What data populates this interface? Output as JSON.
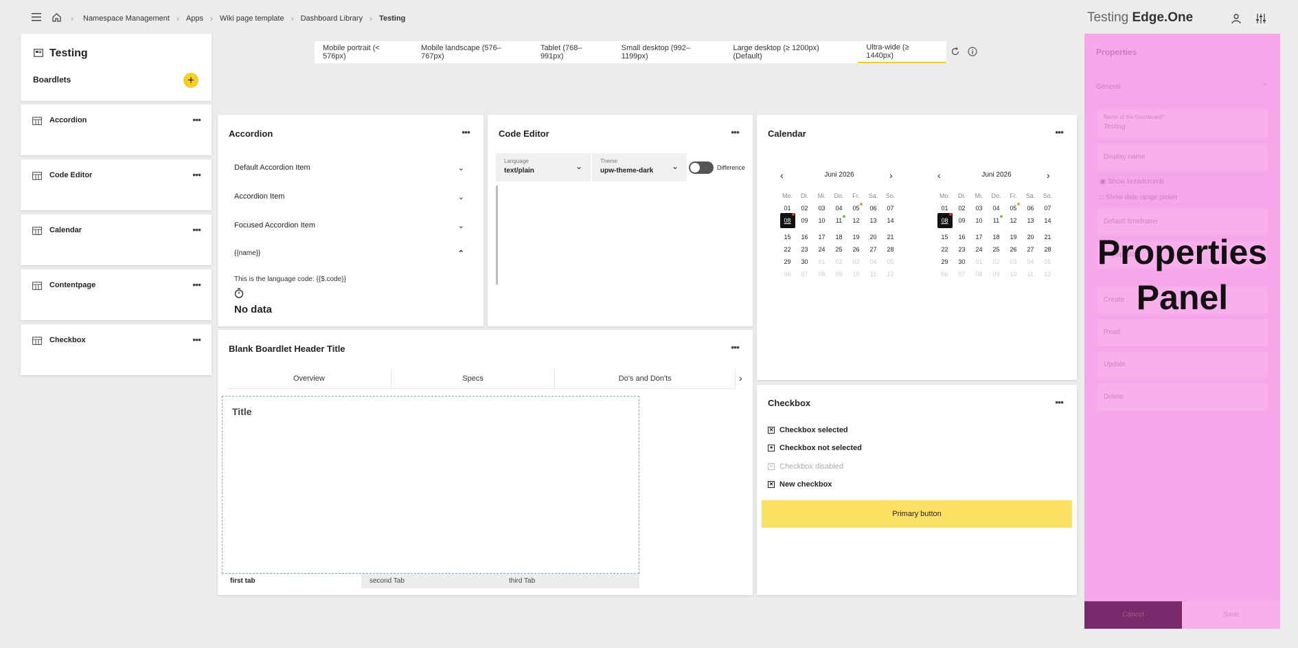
{
  "topbar": {
    "breadcrumbs": [
      "Namespace Management",
      "Apps",
      "Wiki page template",
      "Dashboard Library",
      "Testing"
    ],
    "brand_prefix": "Testing",
    "brand_name": "Edge.One"
  },
  "viewport_tabs": [
    "Mobile portrait (< 576px)",
    "Mobile landscape (576–767px)",
    "Tablet (768–991px)",
    "Small desktop (992–1199px)",
    "Large desktop (≥ 1200px) (Default)",
    "Ultra-wide (≥ 1440px)"
  ],
  "active_viewport_index": 5,
  "sidebar": {
    "title": "Testing",
    "boardlets_label": "Boardlets",
    "items": [
      "Accordion",
      "Code Editor",
      "Calendar",
      "Contentpage",
      "Checkbox"
    ]
  },
  "accordion": {
    "title": "Accordion",
    "items": [
      "Default Accordion Item",
      "Accordion Item",
      "Focused Accordion Item",
      "{{name}}"
    ],
    "content": "This is the language code: {{$.code}}",
    "no_data": "No data"
  },
  "code_editor": {
    "title": "Code Editor",
    "language_label": "Language",
    "language_value": "text/plain",
    "theme_label": "Theme",
    "theme_value": "upw-theme-dark",
    "toggle_label": "Difference"
  },
  "calendar": {
    "title": "Calendar",
    "month_label": "Juni 2026",
    "weekdays": [
      "Mo.",
      "Di.",
      "Mi.",
      "Do.",
      "Fr.",
      "Sa.",
      "So."
    ],
    "days": [
      "01",
      "02",
      "03",
      "04",
      "05",
      "06",
      "07",
      "08",
      "09",
      "10",
      "11",
      "12",
      "13",
      "14",
      "15",
      "16",
      "17",
      "18",
      "19",
      "20",
      "21",
      "22",
      "23",
      "24",
      "25",
      "26",
      "27",
      "28",
      "29",
      "30",
      "01",
      "02",
      "03",
      "04",
      "05",
      "06",
      "07",
      "08",
      "09",
      "10",
      "11",
      "12"
    ],
    "current_month_day_count": 30,
    "today": "08",
    "colors": {
      "orange_dot": "#f0a020",
      "green_dot": "#7bc043",
      "red_dot": "#e53935"
    }
  },
  "blank_boardlet": {
    "title": "Blank Boardlet Header Title",
    "tabs": [
      "Overview",
      "Specs",
      "Do's and Don'ts"
    ],
    "content_title": "Title",
    "bottom_tabs": [
      "first tab",
      "second Tab",
      "third Tab"
    ]
  },
  "checkbox": {
    "title": "Checkbox",
    "items": [
      "Checkbox selected",
      "Checkbox not selected",
      "Checkbox disabled",
      "New checkbox"
    ],
    "button_label": "Primary button",
    "colors": {
      "button": "#fae164"
    }
  },
  "properties": {
    "overlay_label": "Properties Panel",
    "header": "Properties",
    "section": "General",
    "name_label": "Name of the Dashboard*",
    "name_value": "Testing",
    "display_name": "Display name",
    "show_breadcrumb": "Show breadcrumb",
    "show_date_range": "Show date range picker",
    "default_timeframe": "Default timeframe",
    "popup_size": "Popup Size",
    "sections": [
      "Create",
      "Read",
      "Update",
      "Delete"
    ],
    "cancel": "Cancel",
    "save": "Save",
    "colors": {
      "overlay": "#f8a6ea",
      "cancel": "#7a2a6c"
    }
  }
}
